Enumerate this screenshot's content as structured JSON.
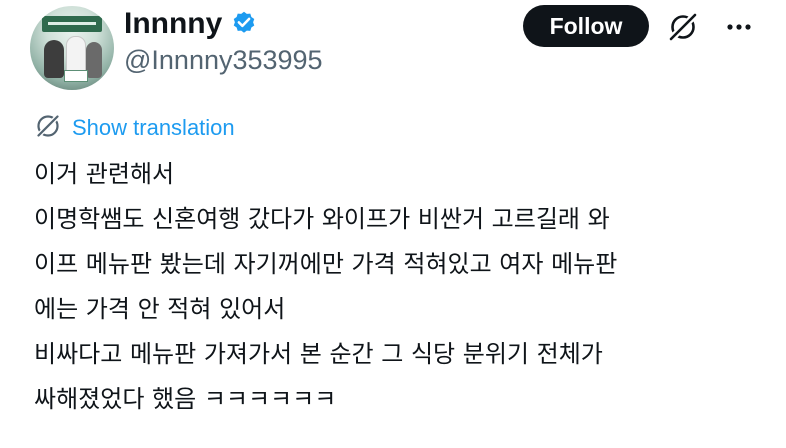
{
  "author": {
    "display_name": "Innnny",
    "handle": "@Innnny353995",
    "verified": true,
    "avatar_icon": "profile-photo"
  },
  "actions": {
    "follow_label": "Follow",
    "grok_icon": "grok-icon",
    "more_icon": "more-icon"
  },
  "translation": {
    "label": "Show translation",
    "icon": "globe-icon"
  },
  "tweet": {
    "lines": [
      "이거 관련해서",
      "이명학쌤도 신혼여행 갔다가 와이프가 비싼거 고르길래 와",
      "이프 메뉴판 봤는데 자기꺼에만 가격 적혀있고 여자 메뉴판",
      "에는 가격 안 적혀 있어서",
      "비싸다고 메뉴판 가져가서 본 순간 그 식당 분위기 전체가",
      "싸해졌었다 했음 ㅋㅋㅋㅋㅋㅋ"
    ]
  },
  "colors": {
    "text": "#0f1419",
    "secondary": "#536471",
    "link": "#1d9bf0",
    "verified_badge": "#1d9bf0",
    "button_bg": "#0f1419"
  }
}
